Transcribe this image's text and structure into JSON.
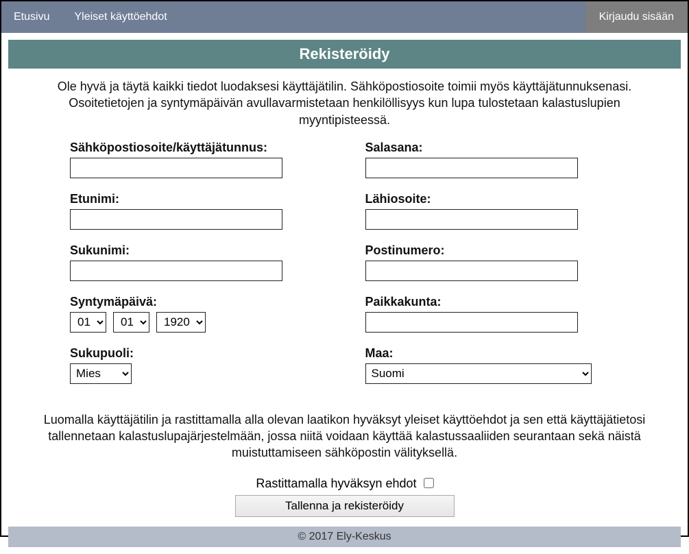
{
  "nav": {
    "home": "Etusivu",
    "terms": "Yleiset käyttöehdot",
    "login": "Kirjaudu sisään"
  },
  "page": {
    "title": "Rekisteröidy",
    "intro": "Ole hyvä ja täytä kaikki tiedot luodaksesi käyttäjätilin. Sähköpostiosoite toimii myös käyttäjätunnuksenasi. Osoitetietojen ja syntymäpäivän avullavarmistetaan henkilöllisyys kun lupa tulostetaan kalastuslupien myyntipisteessä."
  },
  "form": {
    "email_label": "Sähköpostiosoite/käyttäjätunnus:",
    "email_value": "",
    "firstname_label": "Etunimi:",
    "firstname_value": "",
    "lastname_label": "Sukunimi:",
    "lastname_value": "",
    "dob_label": "Syntymäpäivä:",
    "dob_day": "01",
    "dob_month": "01",
    "dob_year": "1920",
    "gender_label": "Sukupuoli:",
    "gender_value": "Mies",
    "password_label": "Salasana:",
    "password_value": "",
    "address_label": "Lähiosoite:",
    "address_value": "",
    "postal_label": "Postinumero:",
    "postal_value": "",
    "city_label": "Paikkakunta:",
    "city_value": "",
    "country_label": "Maa:",
    "country_value": "Suomi"
  },
  "consent": {
    "text": "Luomalla käyttäjätilin ja rastittamalla alla olevan laatikon hyväksyt yleiset käyttöehdot ja sen että käyttäjätietosi tallennetaan kalastuslupajärjestelmään, jossa niitä voidaan käyttää kalastussaaliiden seurantaan sekä näistä muistuttamiseen sähköpostin välityksellä.",
    "accept_label": "Rastittamalla hyväksyn ehdot",
    "submit_label": "Tallenna ja rekisteröidy"
  },
  "footer": {
    "text": "© 2017 Ely-Keskus"
  }
}
